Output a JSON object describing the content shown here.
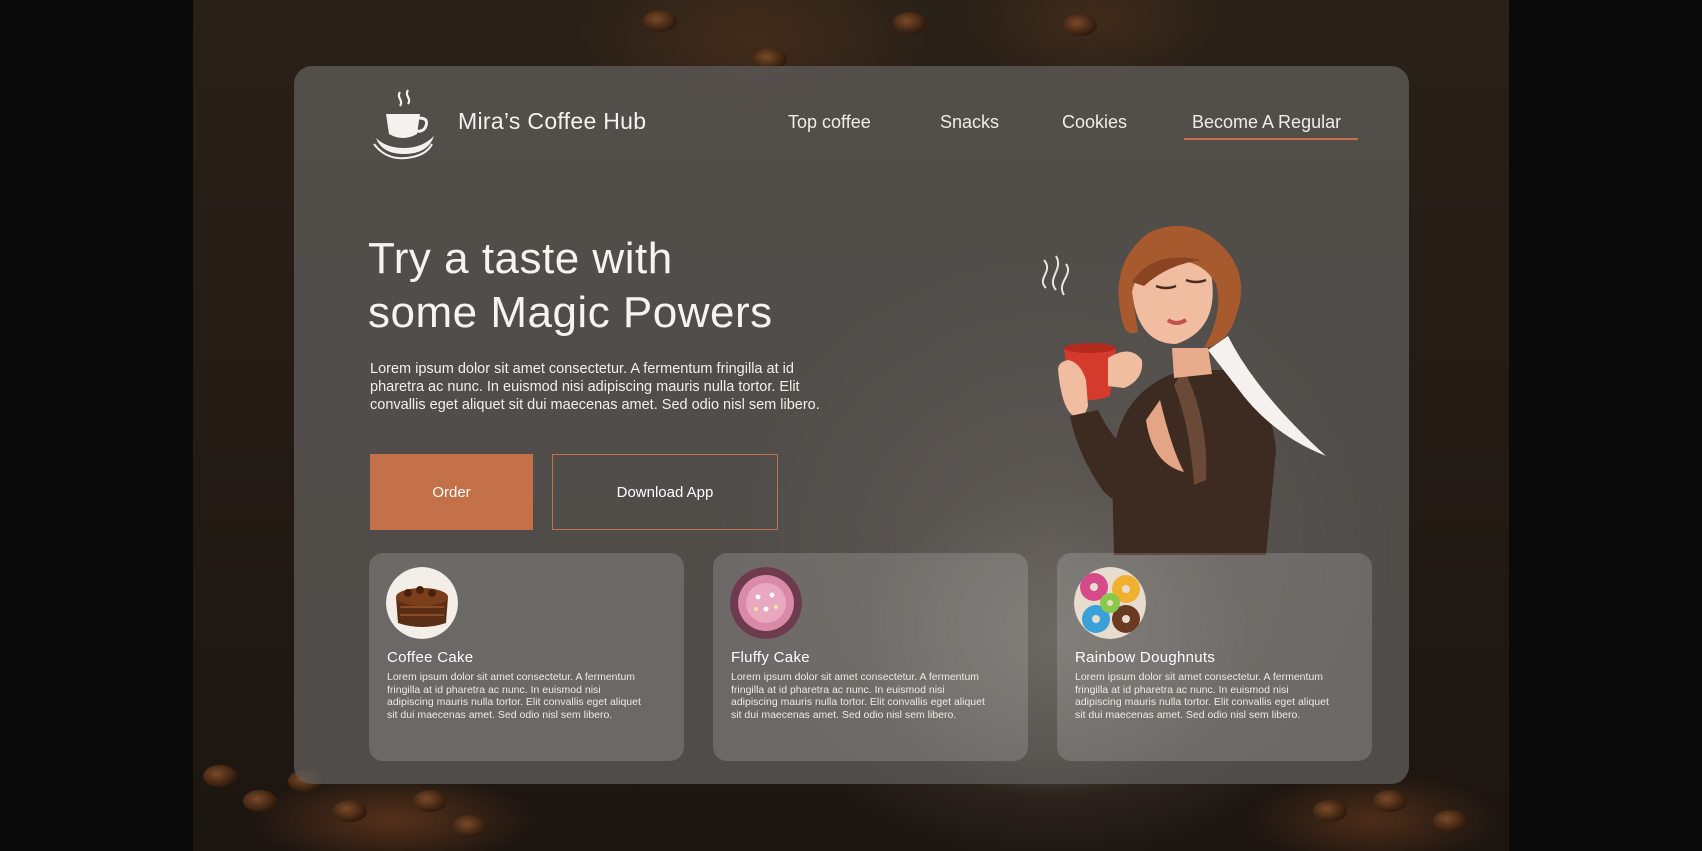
{
  "brand": {
    "name": "Mira’s Coffee Hub",
    "logo_icon": "coffee-cup-icon"
  },
  "nav": {
    "items": [
      {
        "label": "Top coffee"
      },
      {
        "label": "Snacks"
      },
      {
        "label": "Cookies"
      },
      {
        "label": "Become A Regular",
        "active": true
      }
    ]
  },
  "hero": {
    "headline_line1": "Try a taste with",
    "headline_line2": "some Magic Powers",
    "description": "Lorem ipsum dolor sit amet consectetur. A fermentum fringilla at id pharetra ac nunc. In euismod nisi adipiscing mauris nulla tortor. Elit convallis eget aliquet sit dui maecenas amet. Sed odio nisl sem libero.",
    "order_label": "Order",
    "download_label": "Download App"
  },
  "cards": [
    {
      "title": "Coffee Cake",
      "text": "Lorem ipsum dolor sit amet consectetur. A fermentum fringilla at id pharetra ac nunc. In euismod nisi adipiscing mauris nulla tortor. Elit convallis eget aliquet sit dui maecenas amet. Sed odio nisl sem libero.",
      "icon": "chocolate-cake-icon"
    },
    {
      "title": "Fluffy Cake",
      "text": "Lorem ipsum dolor sit amet consectetur. A fermentum fringilla at id pharetra ac nunc. In euismod nisi adipiscing mauris nulla tortor. Elit convallis eget aliquet sit dui maecenas amet. Sed odio nisl sem libero.",
      "icon": "pink-cake-icon"
    },
    {
      "title": "Rainbow Doughnuts",
      "text": "Lorem ipsum dolor sit amet consectetur. A fermentum fringilla at id pharetra ac nunc. In euismod nisi adipiscing mauris nulla tortor. Elit convallis eget aliquet sit dui maecenas amet. Sed odio nisl sem libero.",
      "icon": "doughnuts-icon"
    }
  ],
  "colors": {
    "accent": "#c4714a",
    "panel": "#5c5a58",
    "text": "#f4f1ee"
  }
}
